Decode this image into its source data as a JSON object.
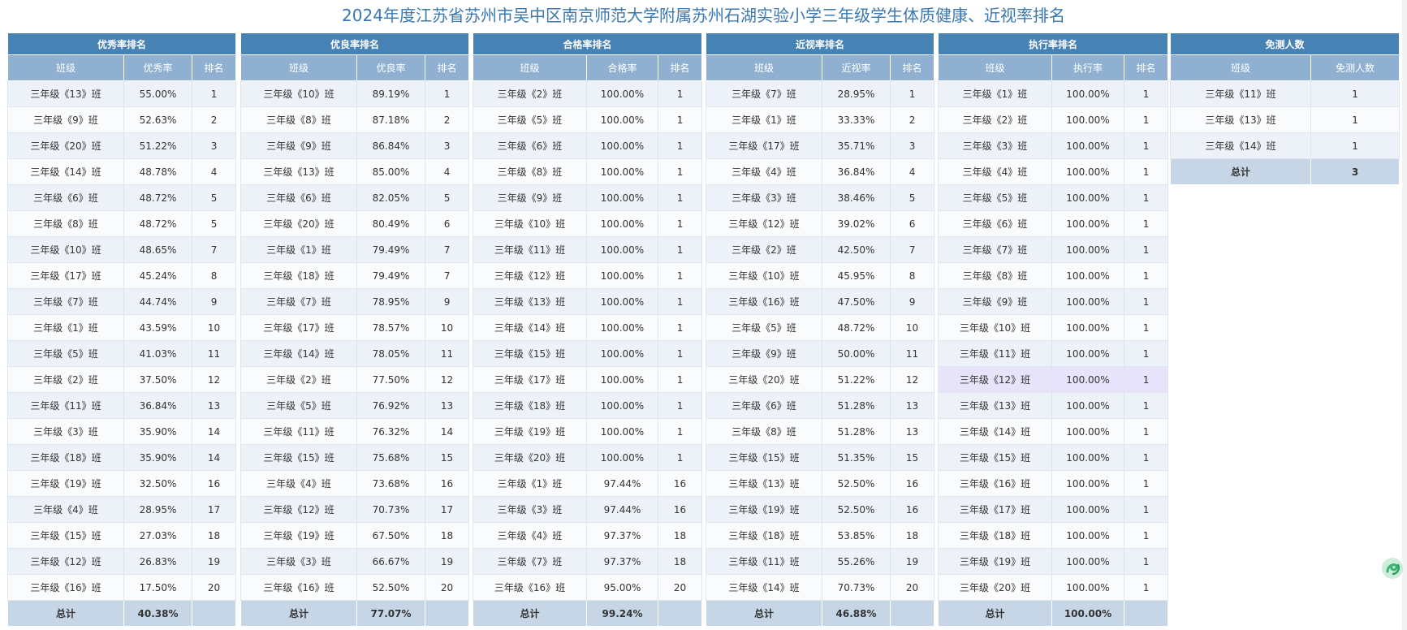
{
  "title": "2024年度江苏省苏州市吴中区南京师范大学附属苏州石湖实验小学三年级学生体质健康、近视率排名",
  "colors": {
    "header_bg": "#4682b4",
    "subheader_bg": "#8fb0d1",
    "total_bg": "#c7d6e6",
    "highlight_row": "#e6e3fa",
    "title": "#3a78b0",
    "brand_icon": "#3cb371"
  },
  "icons": {
    "brand": "brand-swirl-icon"
  },
  "tables": [
    {
      "id": "youxiu",
      "title": "优秀率排名",
      "columns": [
        "班级",
        "优秀率",
        "排名"
      ],
      "rows": [
        [
          "三年级《13》班",
          "55.00%",
          "1"
        ],
        [
          "三年级《9》班",
          "52.63%",
          "2"
        ],
        [
          "三年级《20》班",
          "51.22%",
          "3"
        ],
        [
          "三年级《14》班",
          "48.78%",
          "4"
        ],
        [
          "三年级《6》班",
          "48.72%",
          "5"
        ],
        [
          "三年级《8》班",
          "48.72%",
          "5"
        ],
        [
          "三年级《10》班",
          "48.65%",
          "7"
        ],
        [
          "三年级《17》班",
          "45.24%",
          "8"
        ],
        [
          "三年级《7》班",
          "44.74%",
          "9"
        ],
        [
          "三年级《1》班",
          "43.59%",
          "10"
        ],
        [
          "三年级《5》班",
          "41.03%",
          "11"
        ],
        [
          "三年级《2》班",
          "37.50%",
          "12"
        ],
        [
          "三年级《11》班",
          "36.84%",
          "13"
        ],
        [
          "三年级《3》班",
          "35.90%",
          "14"
        ],
        [
          "三年级《18》班",
          "35.90%",
          "14"
        ],
        [
          "三年级《19》班",
          "32.50%",
          "16"
        ],
        [
          "三年级《4》班",
          "28.95%",
          "17"
        ],
        [
          "三年级《15》班",
          "27.03%",
          "18"
        ],
        [
          "三年级《12》班",
          "26.83%",
          "19"
        ],
        [
          "三年级《16》班",
          "17.50%",
          "20"
        ]
      ],
      "total": [
        "总计",
        "40.38%",
        ""
      ]
    },
    {
      "id": "youliang",
      "title": "优良率排名",
      "columns": [
        "班级",
        "优良率",
        "排名"
      ],
      "rows": [
        [
          "三年级《10》班",
          "89.19%",
          "1"
        ],
        [
          "三年级《8》班",
          "87.18%",
          "2"
        ],
        [
          "三年级《9》班",
          "86.84%",
          "3"
        ],
        [
          "三年级《13》班",
          "85.00%",
          "4"
        ],
        [
          "三年级《6》班",
          "82.05%",
          "5"
        ],
        [
          "三年级《20》班",
          "80.49%",
          "6"
        ],
        [
          "三年级《1》班",
          "79.49%",
          "7"
        ],
        [
          "三年级《18》班",
          "79.49%",
          "7"
        ],
        [
          "三年级《7》班",
          "78.95%",
          "9"
        ],
        [
          "三年级《17》班",
          "78.57%",
          "10"
        ],
        [
          "三年级《14》班",
          "78.05%",
          "11"
        ],
        [
          "三年级《2》班",
          "77.50%",
          "12"
        ],
        [
          "三年级《5》班",
          "76.92%",
          "13"
        ],
        [
          "三年级《11》班",
          "76.32%",
          "14"
        ],
        [
          "三年级《15》班",
          "75.68%",
          "15"
        ],
        [
          "三年级《4》班",
          "73.68%",
          "16"
        ],
        [
          "三年级《12》班",
          "70.73%",
          "17"
        ],
        [
          "三年级《19》班",
          "67.50%",
          "18"
        ],
        [
          "三年级《3》班",
          "66.67%",
          "19"
        ],
        [
          "三年级《16》班",
          "52.50%",
          "20"
        ]
      ],
      "total": [
        "总计",
        "77.07%",
        ""
      ]
    },
    {
      "id": "hege",
      "title": "合格率排名",
      "columns": [
        "班级",
        "合格率",
        "排名"
      ],
      "rows": [
        [
          "三年级《2》班",
          "100.00%",
          "1"
        ],
        [
          "三年级《5》班",
          "100.00%",
          "1"
        ],
        [
          "三年级《6》班",
          "100.00%",
          "1"
        ],
        [
          "三年级《8》班",
          "100.00%",
          "1"
        ],
        [
          "三年级《9》班",
          "100.00%",
          "1"
        ],
        [
          "三年级《10》班",
          "100.00%",
          "1"
        ],
        [
          "三年级《11》班",
          "100.00%",
          "1"
        ],
        [
          "三年级《12》班",
          "100.00%",
          "1"
        ],
        [
          "三年级《13》班",
          "100.00%",
          "1"
        ],
        [
          "三年级《14》班",
          "100.00%",
          "1"
        ],
        [
          "三年级《15》班",
          "100.00%",
          "1"
        ],
        [
          "三年级《17》班",
          "100.00%",
          "1"
        ],
        [
          "三年级《18》班",
          "100.00%",
          "1"
        ],
        [
          "三年级《19》班",
          "100.00%",
          "1"
        ],
        [
          "三年级《20》班",
          "100.00%",
          "1"
        ],
        [
          "三年级《1》班",
          "97.44%",
          "16"
        ],
        [
          "三年级《3》班",
          "97.44%",
          "16"
        ],
        [
          "三年级《4》班",
          "97.37%",
          "18"
        ],
        [
          "三年级《7》班",
          "97.37%",
          "18"
        ],
        [
          "三年级《16》班",
          "95.00%",
          "20"
        ]
      ],
      "total": [
        "总计",
        "99.24%",
        ""
      ]
    },
    {
      "id": "jinshi",
      "title": "近视率排名",
      "columns": [
        "班级",
        "近视率",
        "排名"
      ],
      "rows": [
        [
          "三年级《7》班",
          "28.95%",
          "1"
        ],
        [
          "三年级《1》班",
          "33.33%",
          "2"
        ],
        [
          "三年级《17》班",
          "35.71%",
          "3"
        ],
        [
          "三年级《4》班",
          "36.84%",
          "4"
        ],
        [
          "三年级《3》班",
          "38.46%",
          "5"
        ],
        [
          "三年级《12》班",
          "39.02%",
          "6"
        ],
        [
          "三年级《2》班",
          "42.50%",
          "7"
        ],
        [
          "三年级《10》班",
          "45.95%",
          "8"
        ],
        [
          "三年级《16》班",
          "47.50%",
          "9"
        ],
        [
          "三年级《5》班",
          "48.72%",
          "10"
        ],
        [
          "三年级《9》班",
          "50.00%",
          "11"
        ],
        [
          "三年级《20》班",
          "51.22%",
          "12"
        ],
        [
          "三年级《6》班",
          "51.28%",
          "13"
        ],
        [
          "三年级《8》班",
          "51.28%",
          "13"
        ],
        [
          "三年级《15》班",
          "51.35%",
          "15"
        ],
        [
          "三年级《13》班",
          "52.50%",
          "16"
        ],
        [
          "三年级《19》班",
          "52.50%",
          "16"
        ],
        [
          "三年级《18》班",
          "53.85%",
          "18"
        ],
        [
          "三年级《11》班",
          "55.26%",
          "19"
        ],
        [
          "三年级《14》班",
          "70.73%",
          "20"
        ]
      ],
      "total": [
        "总计",
        "46.88%",
        ""
      ]
    },
    {
      "id": "zhixing",
      "title": "执行率排名",
      "columns": [
        "班级",
        "执行率",
        "排名"
      ],
      "highlight_row": 11,
      "rows": [
        [
          "三年级《1》班",
          "100.00%",
          "1"
        ],
        [
          "三年级《2》班",
          "100.00%",
          "1"
        ],
        [
          "三年级《3》班",
          "100.00%",
          "1"
        ],
        [
          "三年级《4》班",
          "100.00%",
          "1"
        ],
        [
          "三年级《5》班",
          "100.00%",
          "1"
        ],
        [
          "三年级《6》班",
          "100.00%",
          "1"
        ],
        [
          "三年级《7》班",
          "100.00%",
          "1"
        ],
        [
          "三年级《8》班",
          "100.00%",
          "1"
        ],
        [
          "三年级《9》班",
          "100.00%",
          "1"
        ],
        [
          "三年级《10》班",
          "100.00%",
          "1"
        ],
        [
          "三年级《11》班",
          "100.00%",
          "1"
        ],
        [
          "三年级《12》班",
          "100.00%",
          "1"
        ],
        [
          "三年级《13》班",
          "100.00%",
          "1"
        ],
        [
          "三年级《14》班",
          "100.00%",
          "1"
        ],
        [
          "三年级《15》班",
          "100.00%",
          "1"
        ],
        [
          "三年级《16》班",
          "100.00%",
          "1"
        ],
        [
          "三年级《17》班",
          "100.00%",
          "1"
        ],
        [
          "三年级《18》班",
          "100.00%",
          "1"
        ],
        [
          "三年级《19》班",
          "100.00%",
          "1"
        ],
        [
          "三年级《20》班",
          "100.00%",
          "1"
        ]
      ],
      "total": [
        "总计",
        "100.00%",
        ""
      ]
    },
    {
      "id": "mianche",
      "title": "免测人数",
      "columns": [
        "班级",
        "免测人数"
      ],
      "rows": [
        [
          "三年级《11》班",
          "1"
        ],
        [
          "三年级《13》班",
          "1"
        ],
        [
          "三年级《14》班",
          "1"
        ]
      ],
      "total": [
        "总计",
        "3"
      ]
    }
  ]
}
